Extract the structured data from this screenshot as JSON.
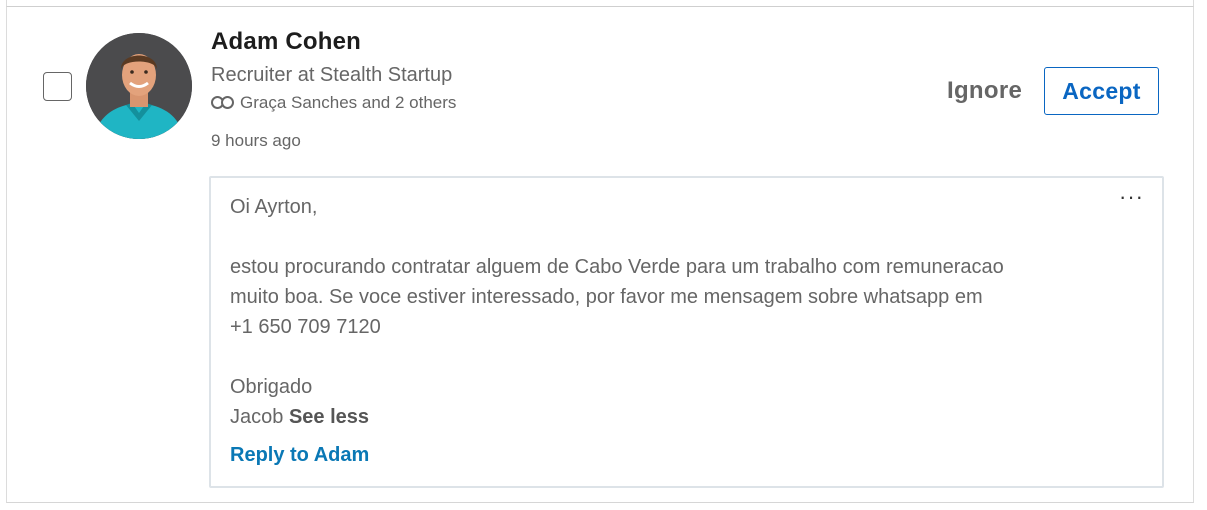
{
  "invitation": {
    "name": "Adam Cohen",
    "headline": "Recruiter at Stealth Startup",
    "mutual": "Graça Sanches and 2 others",
    "time": "9 hours ago",
    "ignore_label": "Ignore",
    "accept_label": "Accept"
  },
  "message": {
    "greeting": "Oi Ayrton,",
    "body_line1": "estou procurando contratar alguem de Cabo Verde para um trabalho com remuneracao",
    "body_line2": "muito boa. Se voce estiver interessado, por favor me mensagem sobre whatsapp em",
    "body_line3": "+1 650 709 7120",
    "closing": "Obrigado",
    "signature": "Jacob",
    "see_less_label": "See less",
    "more_label": "···",
    "reply_label": "Reply to Adam"
  },
  "colors": {
    "accent": "#0a66c2",
    "reply_link": "#0a78b5",
    "avatar_shirt": "#1fb5c4"
  }
}
